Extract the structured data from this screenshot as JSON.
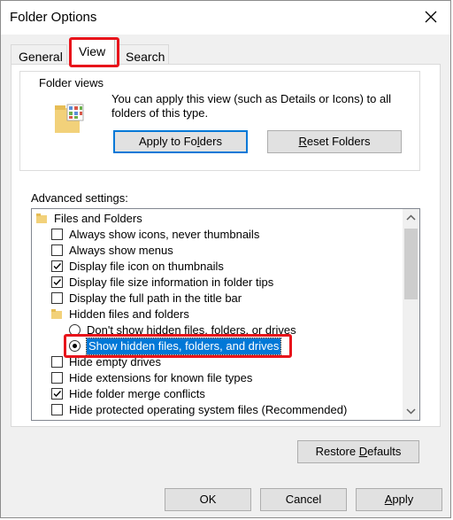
{
  "window": {
    "title": "Folder Options"
  },
  "tabs": [
    {
      "label": "General"
    },
    {
      "label": "View"
    },
    {
      "label": "Search"
    }
  ],
  "folder_views": {
    "group_label": "Folder views",
    "description": "You can apply this view (such as Details or Icons) to all folders of this type.",
    "apply_button": {
      "pre": "Apply to Fo",
      "accel": "l",
      "post": "ders"
    },
    "reset_button": {
      "pre": "",
      "accel": "R",
      "post": "eset Folders"
    }
  },
  "advanced": {
    "label": "Advanced settings:",
    "items": [
      {
        "kind": "folder",
        "indent": 0,
        "label": "Files and Folders"
      },
      {
        "kind": "checkbox",
        "indent": 1,
        "checked": false,
        "label": "Always show icons, never thumbnails"
      },
      {
        "kind": "checkbox",
        "indent": 1,
        "checked": false,
        "label": "Always show menus"
      },
      {
        "kind": "checkbox",
        "indent": 1,
        "checked": true,
        "label": "Display file icon on thumbnails"
      },
      {
        "kind": "checkbox",
        "indent": 1,
        "checked": true,
        "label": "Display file size information in folder tips"
      },
      {
        "kind": "checkbox",
        "indent": 1,
        "checked": false,
        "label": "Display the full path in the title bar"
      },
      {
        "kind": "folder",
        "indent": 1,
        "label": "Hidden files and folders"
      },
      {
        "kind": "radio",
        "indent": 2,
        "checked": false,
        "label": "Don't show hidden files, folders, or drives"
      },
      {
        "kind": "radio",
        "indent": 2,
        "checked": true,
        "selected": true,
        "label": "Show hidden files, folders, and drives"
      },
      {
        "kind": "checkbox",
        "indent": 1,
        "checked": false,
        "label": "Hide empty drives"
      },
      {
        "kind": "checkbox",
        "indent": 1,
        "checked": false,
        "label": "Hide extensions for known file types"
      },
      {
        "kind": "checkbox",
        "indent": 1,
        "checked": true,
        "label": "Hide folder merge conflicts"
      },
      {
        "kind": "checkbox",
        "indent": 1,
        "checked": false,
        "label": "Hide protected operating system files (Recommended)"
      }
    ]
  },
  "restore_button": {
    "pre": "Restore ",
    "accel": "D",
    "post": "efaults"
  },
  "footer": {
    "ok": "OK",
    "cancel": "Cancel",
    "apply": {
      "pre": "",
      "accel": "A",
      "post": "pply"
    }
  },
  "colors": {
    "highlight": "#e8141b",
    "selection": "#0078d7",
    "accent": "#0078d7"
  },
  "icons": [
    "close-icon",
    "folder-icon",
    "scroll-up-arrow-icon",
    "scroll-down-arrow-icon",
    "checkmark-icon"
  ]
}
